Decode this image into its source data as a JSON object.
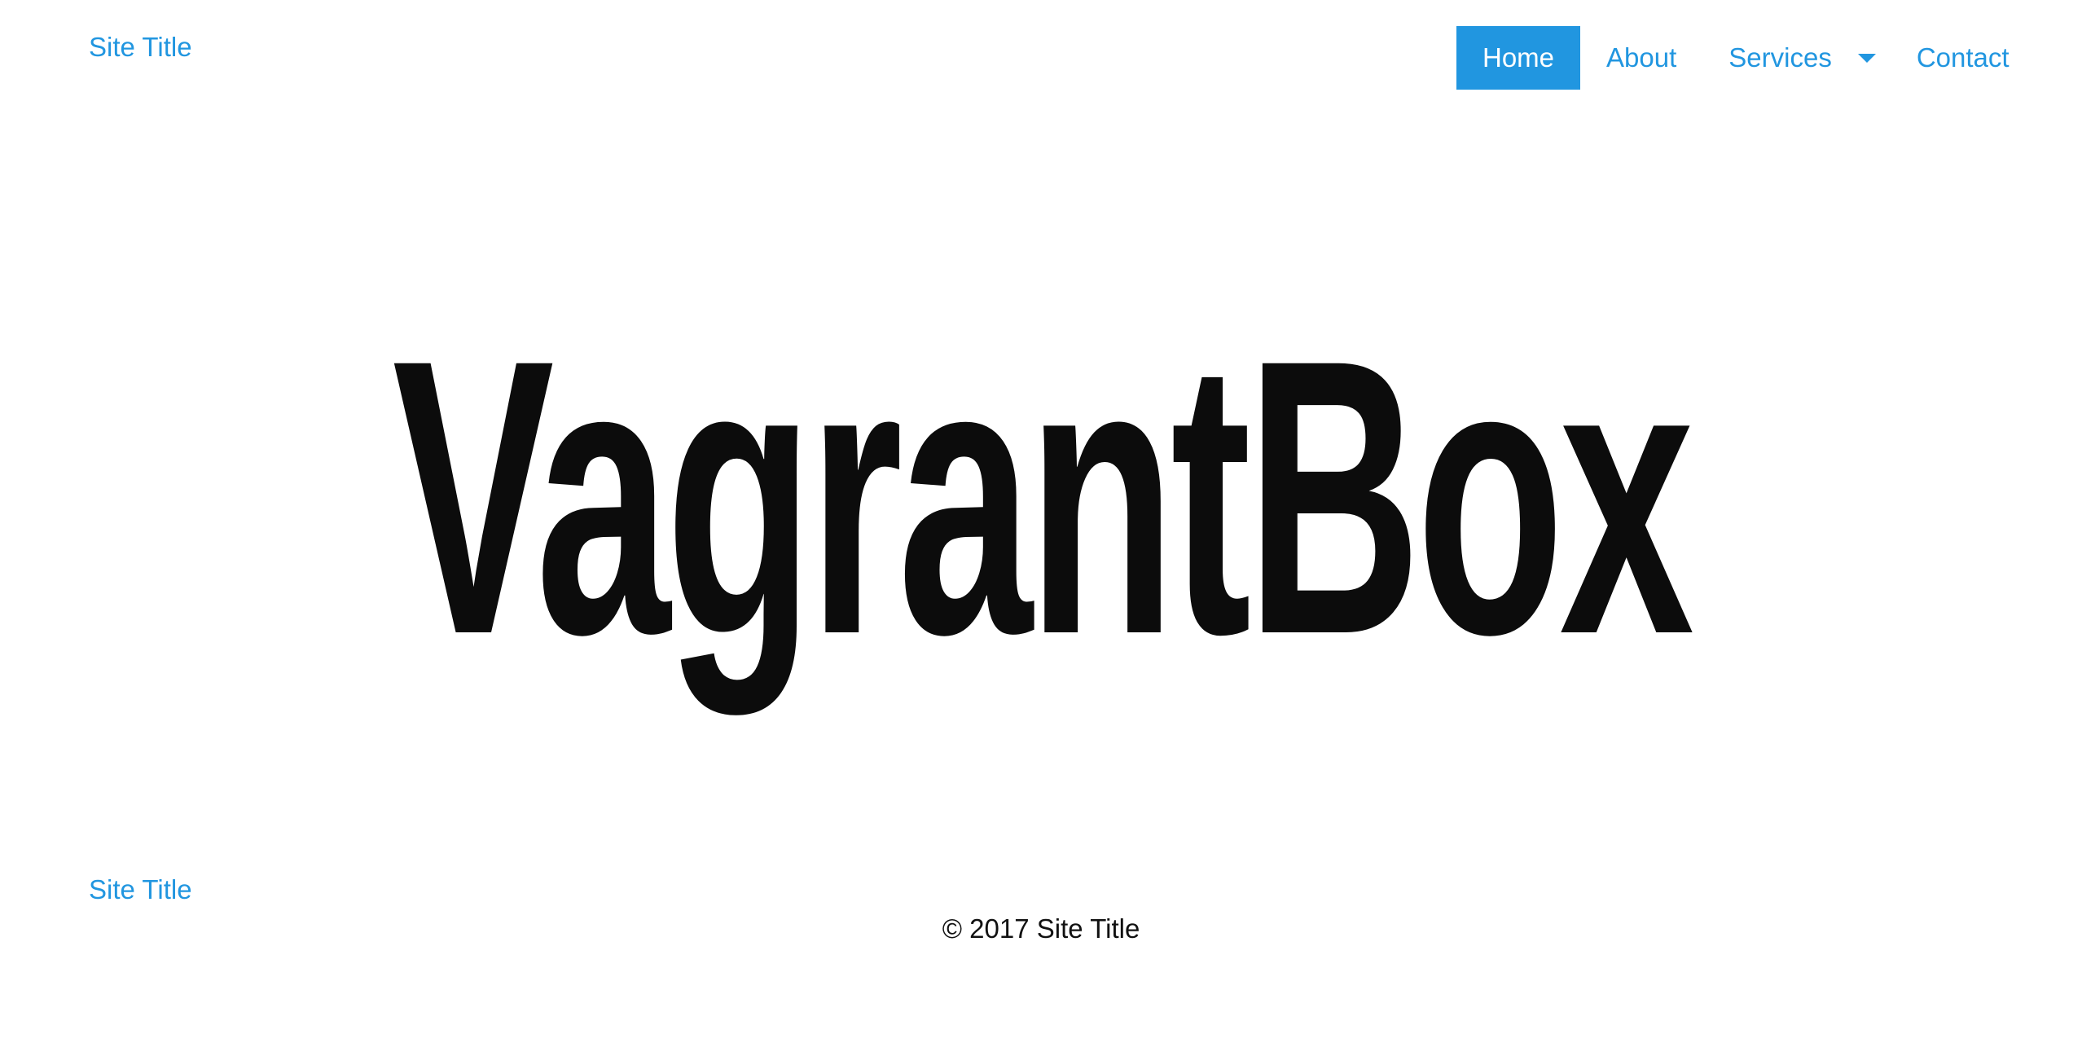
{
  "header": {
    "site_title": "Site Title",
    "nav": {
      "home": "Home",
      "about": "About",
      "services": "Services",
      "contact": "Contact"
    }
  },
  "hero": {
    "title": "VagrantBox"
  },
  "footer": {
    "site_title": "Site Title",
    "copyright": "© 2017 Site Title"
  },
  "colors": {
    "accent": "#2196e0",
    "text": "#0c0c0c",
    "background": "#ffffff"
  },
  "icons": {
    "services_dropdown": "caret-down-icon"
  }
}
